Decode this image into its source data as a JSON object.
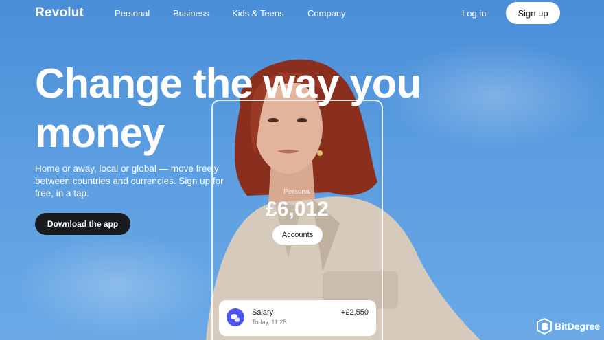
{
  "header": {
    "logo": "Revolut",
    "nav": [
      "Personal",
      "Business",
      "Kids & Teens",
      "Company"
    ],
    "login": "Log in",
    "signup": "Sign up"
  },
  "hero": {
    "headline_line1": "Change the way you",
    "headline_line2": "money",
    "subtext": "Home or away, local or global — move freely between countries and currencies. Sign up for free, in a tap.",
    "download_btn": "Download the app"
  },
  "phone": {
    "account_label": "Personal",
    "balance": "£6,012",
    "accounts_btn": "Accounts",
    "transaction": {
      "name": "Salary",
      "time": "Today, 11:28",
      "amount": "+£2,550",
      "icon": "coins-icon"
    }
  },
  "watermark": {
    "text": "BitDegree",
    "icon": "bitdegree-logo-icon"
  },
  "colors": {
    "sky": "#5b9de0",
    "dark_button": "#191c1f",
    "tx_icon": "#4f55f1"
  }
}
